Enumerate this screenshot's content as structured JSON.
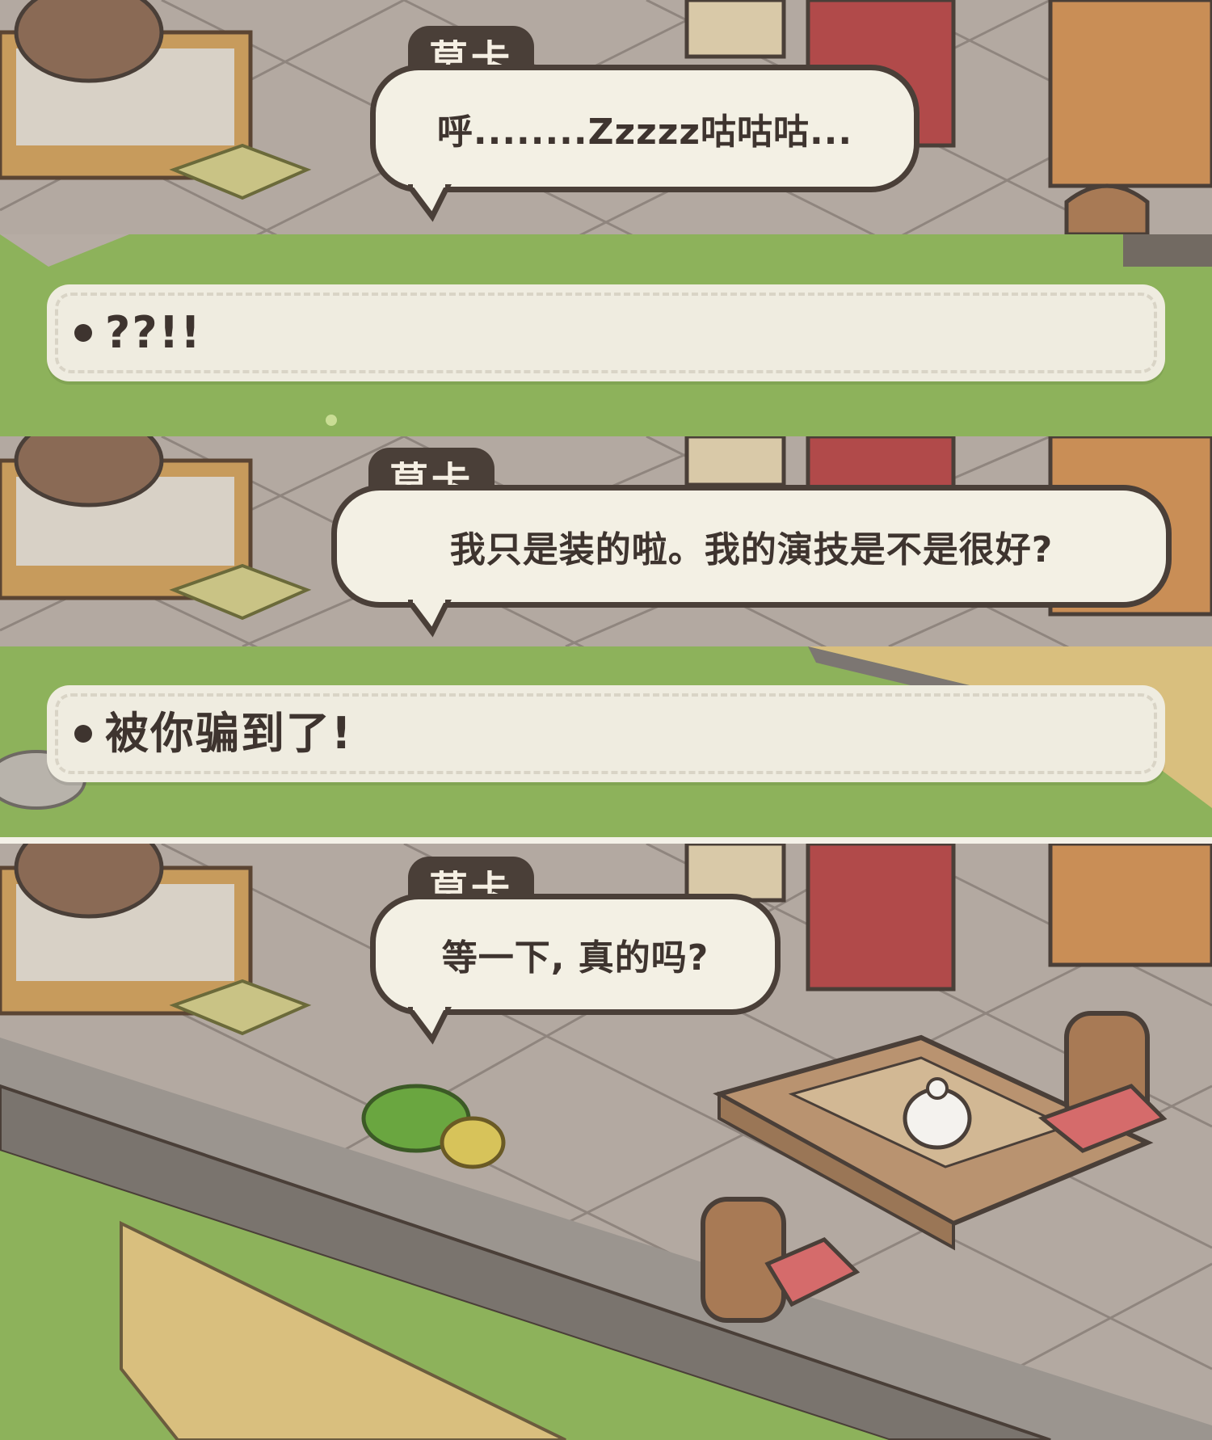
{
  "dialogue": [
    {
      "speaker": "莫卡",
      "text": "呼........Zzzzz咕咕咕..."
    },
    {
      "speaker": "莫卡",
      "text": "我只是装的啦。我的演技是不是很好?"
    },
    {
      "speaker": "莫卡",
      "text": "等一下, 真的吗?"
    }
  ],
  "choices": [
    {
      "label": "??!!"
    },
    {
      "label": "被你骗到了!"
    }
  ],
  "colors": {
    "bubble_fill": "#f3f0e4",
    "bubble_border": "#4a3f38",
    "nametag": "#4a3f38",
    "grass": "#8db25b",
    "choice_fill": "#efece0"
  }
}
